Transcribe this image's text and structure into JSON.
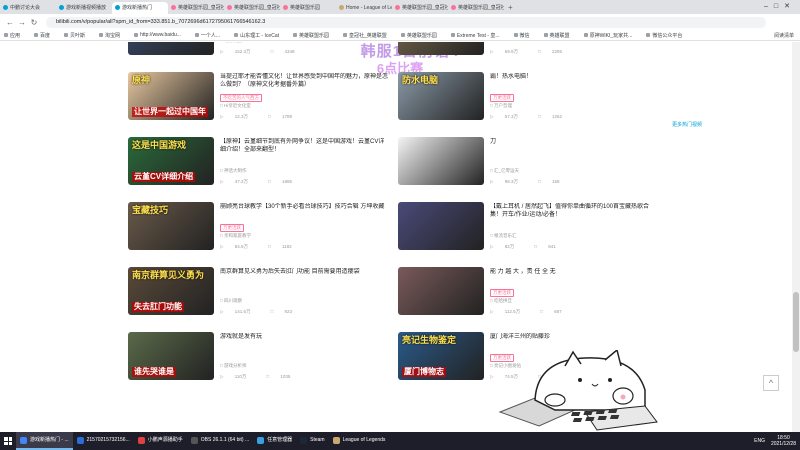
{
  "browser": {
    "tabs": [
      {
        "label": "中鹏讨论大会",
        "active": false,
        "icon": "bilibili"
      },
      {
        "label": "游戏新播视频播放",
        "active": false,
        "icon": "bilibili"
      },
      {
        "label": "游戏新播热门",
        "active": true,
        "icon": "bilibili"
      },
      {
        "label": "英雄联盟乐园_皇冠社",
        "active": false,
        "icon": "bilibili-red"
      },
      {
        "label": "英雄联盟乐园_皇冠社",
        "active": false,
        "icon": "bilibili-red"
      },
      {
        "label": "英雄联盟乐园",
        "active": false,
        "icon": "bilibili-red"
      },
      {
        "label": "Home - League of Le...",
        "active": false,
        "icon": "lol"
      },
      {
        "label": "英雄联盟乐园_皇冠社",
        "active": false,
        "icon": "bilibili-red"
      },
      {
        "label": "英雄联盟乐园_皇冠社",
        "active": false,
        "icon": "bilibili-red"
      }
    ],
    "new_tab": "+",
    "url": "bilibili.com/v/popular/all?spm_id_from=333.851.b_7072696d6172795061766546162.3",
    "bookmarks": [
      "应用",
      "百度",
      "贝叶斯",
      "淘宝网",
      "http://www.baidu...",
      "一个人...",
      "山东理工 - IceCat",
      "英雄联盟乐园",
      "皇冠社_英雄联盟",
      "英雄联盟乐园",
      "Extreme Test - 皇...",
      "微信",
      "英雄联盟",
      "原神WIKI_玩家共...",
      "微信公众平台"
    ],
    "bookmarks_right": "阅读清单"
  },
  "overlay": {
    "line1": "韩服1日前语4",
    "line2": "6点比赛"
  },
  "side_link": "更多热门视频",
  "cards": [
    {
      "title": "",
      "tag": "",
      "up": "幻影汉服",
      "views": "152.3万",
      "comments": "4348",
      "thumb_color": "#3a4a6a",
      "ov": "",
      "ov2": ""
    },
    {
      "title": "",
      "tag": "",
      "up": "",
      "views": "69.9万",
      "comments": "2285",
      "thumb_color": "#7a6a50",
      "ov": "",
      "ov2": ""
    },
    {
      "title": "当提过耶才能否懂文化！让世界感受到中国年的魅力，原神是怎么做到？（原神文化考据番外篇）",
      "tag": "不吃苦的人气西方",
      "up": "Hi亲近文化室",
      "views": "12.3万",
      "comments": "1789",
      "thumb_color": "#e8c8a0",
      "ov": "原神",
      "ov2": "让世界一起过中国年"
    },
    {
      "title": "霸！热水电脑！",
      "tag": "万更活跃",
      "up": "万户哲理",
      "views": "57.3万",
      "comments": "1262",
      "thumb_color": "#8a9aa8",
      "ov": "防水电脑",
      "ov2": ""
    },
    {
      "title": "【原神】云堇细节到底有外网争议！这是中国游戏！云堇CV详细介绍！全部来翻型！",
      "tag": "",
      "up": "神话大制作",
      "views": "47.2万",
      "comments": "1886",
      "thumb_color": "#2a6a3a",
      "ov": "这是中国游戏",
      "ov2": "云堇CV详细介绍"
    },
    {
      "title": "刀",
      "tag": "",
      "up": "汇_亿零运天",
      "views": "98.3万",
      "comments": "158",
      "thumb_color": "#f5f5f5",
      "ov": "",
      "ov2": ""
    },
    {
      "title": "崩顾亮台球教学【30个新手必看台球技巧】技巧合辑 方坤收藏",
      "tag": "万更活跃",
      "up": "亲和家庭教学",
      "views": "84.6万",
      "comments": "1192",
      "thumb_color": "#6a5a4a",
      "ov": "宝藏技巧",
      "ov2": ""
    },
    {
      "title": "【戴上耳机 / 居然起飞】值得你单曲循环的100首宝藏热歌合集！开车/作业/运动/必备！",
      "tag": "",
      "up": "根流音乐汇",
      "views": "82万",
      "comments": "841",
      "thumb_color": "#4a4a7a",
      "ov": "",
      "ov2": ""
    },
    {
      "title": "南京群算见义勇为后失去肛门功能 目前需要用造瘘袋",
      "tag": "",
      "up": "四川观察",
      "views": "141.6万",
      "comments": "923",
      "thumb_color": "#5a4a3a",
      "ov": "南京群算见义勇为",
      "ov2": "失去肛门功能"
    },
    {
      "title": "能 力 越 大 ，责 任 全 无",
      "tag": "万更活跃",
      "up": "吃哈拼旦",
      "views": "112.6万",
      "comments": "687",
      "thumb_color": "#7a5a5a",
      "ov": "",
      "ov2": ""
    },
    {
      "title": "游戏就是发有玩",
      "tag": "",
      "up": "游戏分析师",
      "views": "110万",
      "comments": "1035",
      "thumb_color": "#5a6a4a",
      "ov": "",
      "ov2": "谁先哭谁是"
    },
    {
      "title": "厦门海洋三州的贴藤珍",
      "tag": "万更活跃",
      "up": "亮记小图发帖",
      "views": "74.5万",
      "comments": "2353",
      "thumb_color": "#2a5a8a",
      "ov": "亮记生物鉴定",
      "ov2": "厦门博物志"
    }
  ],
  "back_to_top": "^",
  "taskbar": {
    "items": [
      {
        "label": "游戏新播热门 - ...",
        "active": true,
        "color": "#4285f4"
      },
      {
        "label": "21570215732156...",
        "active": false,
        "color": "#2b6fd6"
      },
      {
        "label": "小鹏声源播助手",
        "active": false,
        "color": "#e04040"
      },
      {
        "label": "OBS 26.1.1 (64 bit) ...",
        "active": false,
        "color": "#555"
      },
      {
        "label": "任意管理器",
        "active": false,
        "color": "#3aa0e0"
      },
      {
        "label": "Steam",
        "active": false,
        "color": "#1b2838"
      },
      {
        "label": "League of Legends",
        "active": false,
        "color": "#c8aa6e"
      }
    ],
    "lang": "ENG",
    "time": "18:50",
    "date": "2021/12/28"
  }
}
